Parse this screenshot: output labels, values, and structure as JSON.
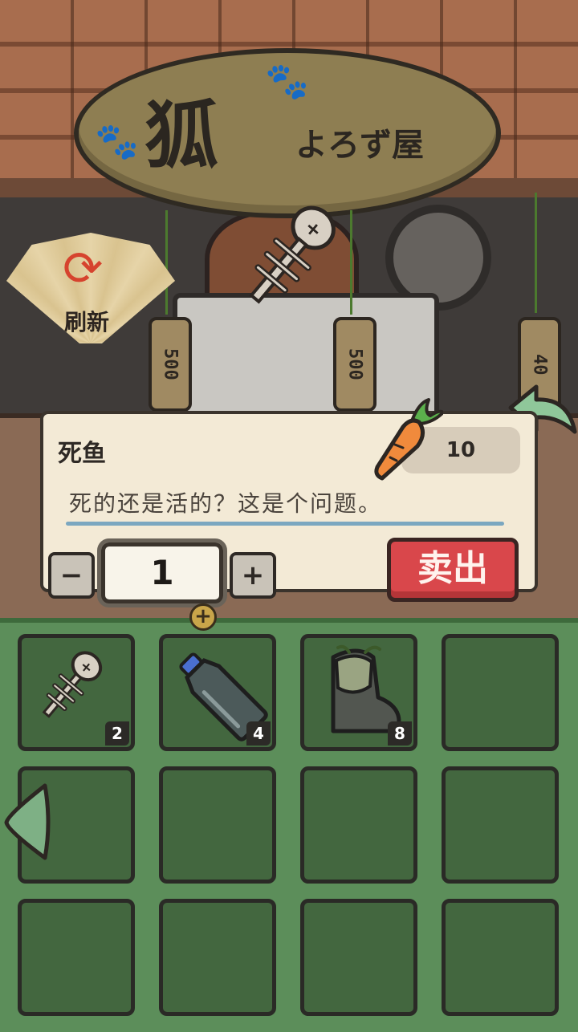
{
  "shop": {
    "sign_main": "狐",
    "sign_sub": "よろず屋",
    "refresh_label": "刷新",
    "tags": [
      "500",
      "500",
      "40"
    ]
  },
  "item": {
    "name": "死鱼",
    "price": "10",
    "currency_icon": "carrot-icon",
    "description": "死的还是活的？这是个问题。"
  },
  "quantity": {
    "minus_label": "−",
    "value": "1",
    "plus_label": "+"
  },
  "sell_label": "卖出",
  "inventory": {
    "slots": [
      {
        "item": "fish-bone",
        "count": "2"
      },
      {
        "item": "plastic-bottle",
        "count": "4"
      },
      {
        "item": "old-boot",
        "count": "8"
      },
      {
        "item": "",
        "count": ""
      },
      {
        "item": "",
        "count": ""
      },
      {
        "item": "",
        "count": ""
      },
      {
        "item": "",
        "count": ""
      },
      {
        "item": "",
        "count": ""
      },
      {
        "item": "",
        "count": ""
      },
      {
        "item": "",
        "count": ""
      },
      {
        "item": "",
        "count": ""
      },
      {
        "item": "",
        "count": ""
      }
    ]
  },
  "colors": {
    "sell_button": "#d9474b",
    "inventory_bg": "#5c8e5a",
    "slot_bg": "#43673f",
    "panel_bg": "#f3ead6"
  }
}
